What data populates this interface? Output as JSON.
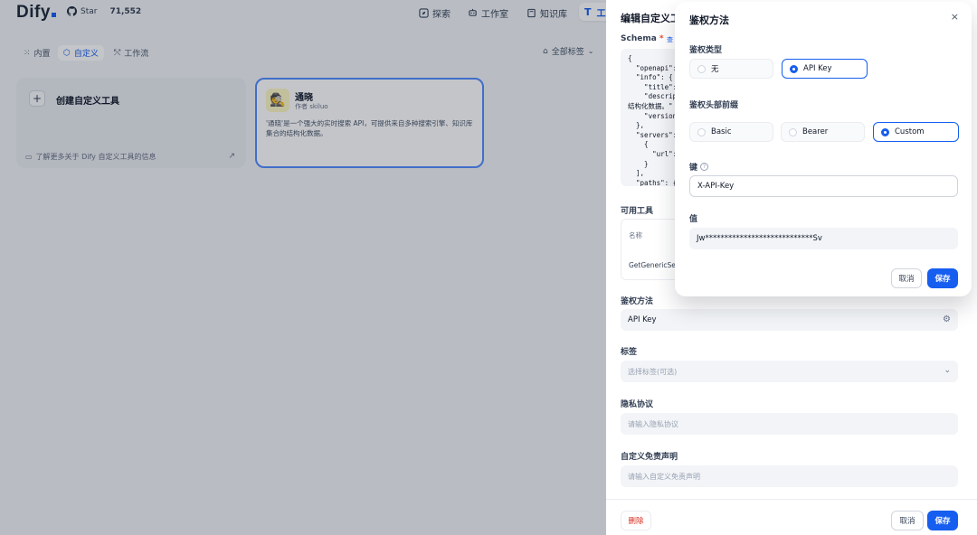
{
  "topbar": {
    "logo": "Dify",
    "star_label": "Star",
    "star_count": "71,552",
    "nav": {
      "explore": "探索",
      "studio": "工作室",
      "knowledge": "知识库",
      "tools": "工"
    }
  },
  "subbar": {
    "tabs": {
      "builtin": "内置",
      "custom": "自定义",
      "workflow": "工作流"
    },
    "tag_filter": "全部标签"
  },
  "create_card": {
    "plus": "+",
    "title": "创建自定义工具",
    "footer": "了解更多关于 Dify 自定义工具的信息",
    "arrow": "↗"
  },
  "tool_card": {
    "avatar": "🕵",
    "name": "通晓",
    "author": "作者 skiluo",
    "description": "'通晓'是一个强大的实时搜索 API，可提供来自多种搜索引擎、知识库集合的结构化数据。"
  },
  "drawer": {
    "title": "编辑自定义工",
    "schema_label": "Schema",
    "required_mark": "*",
    "schema_link": "查",
    "schema_code": "{\n  \"openapi\": \n  \"info\": {\n    \"title\": \"\n    \"descript\n结构化数据。\"\n    \"version\"\n  },\n  \"servers\": [\n    {\n      \"url\": \"\n    }\n  ],\n  \"paths\": {",
    "available_tools_label": "可用工具",
    "tools_col_name": "名称",
    "tools_row_name": "GetGenericSea",
    "auth_label": "鉴权方法",
    "auth_value": "API Key",
    "tags_label": "标签",
    "tags_placeholder": "选择标签(可选)",
    "privacy_label": "隐私协议",
    "privacy_placeholder": "请输入隐私协议",
    "disclaimer_label": "自定义免责声明",
    "disclaimer_placeholder": "请输入自定义免责声明",
    "delete_label": "删除",
    "cancel_label": "取消",
    "save_label": "保存"
  },
  "modal": {
    "title": "鉴权方法",
    "close": "×",
    "auth_type_label": "鉴权类型",
    "auth_types": [
      "无",
      "API Key"
    ],
    "auth_type_selected": "API Key",
    "header_prefix_label": "鉴权头部前缀",
    "header_prefixes": [
      "Basic",
      "Bearer",
      "Custom"
    ],
    "header_prefix_selected": "Custom",
    "key_label": "键",
    "help_mark": "?",
    "key_value": "X-API-Key",
    "value_label": "值",
    "value_value": "Jw****************************Sv",
    "cancel_label": "取消",
    "save_label": "保存"
  }
}
